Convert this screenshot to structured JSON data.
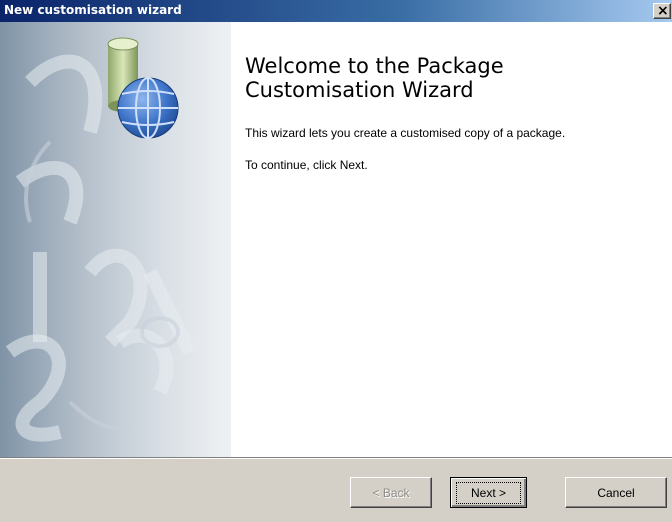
{
  "window": {
    "title": "New customisation wizard",
    "close_glyph": "×"
  },
  "icons": {
    "close": "close-icon",
    "wizard": "database-globe-icon"
  },
  "content": {
    "heading_line1": "Welcome to the Package",
    "heading_line2": "Customisation Wizard",
    "description": "This wizard lets you create a customised copy of a package.",
    "instruction": "To continue, click Next."
  },
  "buttons": {
    "back_label": "< Back",
    "next_label": "Next >",
    "cancel_label": "Cancel",
    "back_enabled": false
  },
  "colors": {
    "title_bar_start": "#0a246a",
    "title_bar_end": "#a6caf0",
    "dialog_face": "#d4d0c8",
    "content_background": "#ffffff"
  }
}
